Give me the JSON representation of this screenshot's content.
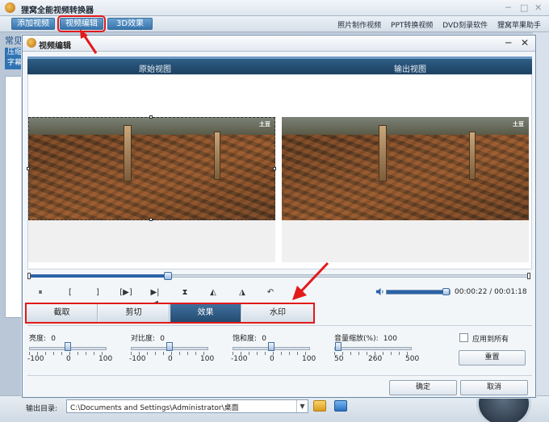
{
  "app": {
    "title": "狸窝全能视频转换器",
    "toolbar": {
      "add_video": "添加视频",
      "video_edit": "视频编辑",
      "effect_3d": "3D效果"
    },
    "top_links": [
      "照片制作视频",
      "PPT转换视频",
      "DVD刻录软件",
      "狸窝苹果助手"
    ],
    "left_tab": "常见",
    "left_items": [
      "压缩",
      "字幕"
    ],
    "output_label": "输出目录:",
    "output_path": "C:\\Documents and Settings\\Administrator\\桌面"
  },
  "dialog": {
    "title": "视频编辑",
    "original_view": "原始视图",
    "output_view": "输出视图",
    "watermark": "土豆",
    "playback": {
      "progress": 0.28,
      "volume": 1.0,
      "time": "00:00:22 / 00:01:18"
    },
    "controls": [
      "⏸",
      "[",
      "]",
      "[▶]",
      "▶|◀",
      "⧗",
      "◭",
      "◮",
      "↶"
    ],
    "tabs": [
      {
        "label": "截取",
        "active": false
      },
      {
        "label": "剪切",
        "active": false
      },
      {
        "label": "效果",
        "active": true
      },
      {
        "label": "水印",
        "active": false
      }
    ],
    "sliders": {
      "brightness": {
        "label": "亮度:",
        "value": "0",
        "min": "-100",
        "mid": "0",
        "max": "100",
        "level": 0.5
      },
      "contrast": {
        "label": "对比度:",
        "value": "0",
        "min": "-100",
        "mid": "0",
        "max": "100",
        "level": 0.5
      },
      "saturation": {
        "label": "饱和度:",
        "value": "0",
        "min": "-100",
        "mid": "0",
        "max": "100",
        "level": 0.5
      },
      "volume_zoom": {
        "label": "音量缩放(%):",
        "value": "100",
        "min": "50",
        "mid": "260",
        "max": "500",
        "level": 0.05
      }
    },
    "apply_all": "应用到所有",
    "reset": "重置",
    "ok": "确定",
    "cancel": "取消"
  },
  "colors": {
    "highlight": "#e21a1a",
    "accent": "#2a62a8",
    "header": "#1c3f60"
  }
}
